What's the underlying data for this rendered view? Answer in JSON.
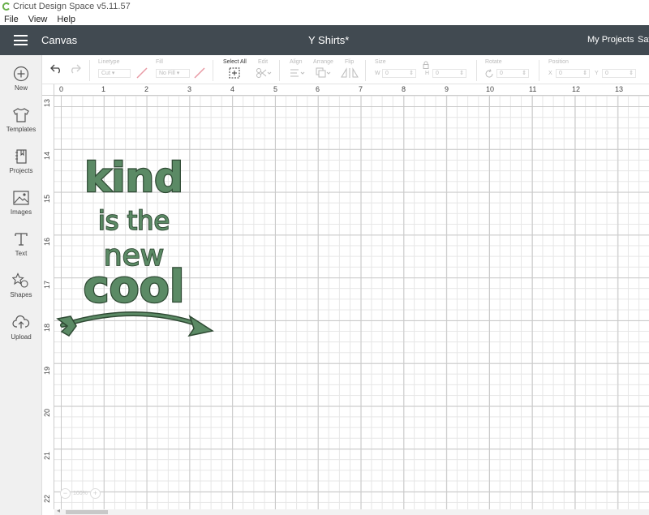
{
  "app": {
    "title": "Cricut Design Space  v5.11.57"
  },
  "menu": [
    "File",
    "View",
    "Help"
  ],
  "header": {
    "canvas_label": "Canvas",
    "project_title": "Y Shirts*",
    "my_projects": "My Projects",
    "save": "Sav"
  },
  "sidebar": {
    "items": [
      {
        "label": "New",
        "icon": "plus-circle-icon"
      },
      {
        "label": "Templates",
        "icon": "tshirt-icon"
      },
      {
        "label": "Projects",
        "icon": "notebook-icon"
      },
      {
        "label": "Images",
        "icon": "image-icon"
      },
      {
        "label": "Text",
        "icon": "text-t-icon"
      },
      {
        "label": "Shapes",
        "icon": "shapes-icon"
      },
      {
        "label": "Upload",
        "icon": "cloud-upload-icon"
      }
    ]
  },
  "toolbar": {
    "linetype_label": "Linetype",
    "linetype_value": "Cut",
    "fill_label": "Fill",
    "fill_value": "No Fill",
    "select_all_label": "Select All",
    "edit_label": "Edit",
    "align_label": "Align",
    "arrange_label": "Arrange",
    "flip_label": "Flip",
    "size_label": "Size",
    "w_label": "W",
    "w_value": "0",
    "h_label": "H",
    "h_value": "0",
    "rotate_label": "Rotate",
    "rotate_value": "0",
    "position_label": "Position",
    "x_label": "X",
    "x_value": "0",
    "y_label": "Y",
    "y_value": "0"
  },
  "rulers": {
    "top": [
      "0",
      "1",
      "2",
      "3",
      "4",
      "5",
      "6",
      "7",
      "8",
      "9",
      "10",
      "11",
      "12",
      "13"
    ],
    "left": [
      "13",
      "14",
      "15",
      "16",
      "17",
      "18",
      "19",
      "20",
      "21",
      "22"
    ]
  },
  "design": {
    "line1": "kind",
    "line2": "is the",
    "line3": "new",
    "line4": "cool",
    "color": "#5b8a65"
  },
  "zoom": {
    "value": "100%",
    "minus": "−",
    "plus": "+"
  }
}
